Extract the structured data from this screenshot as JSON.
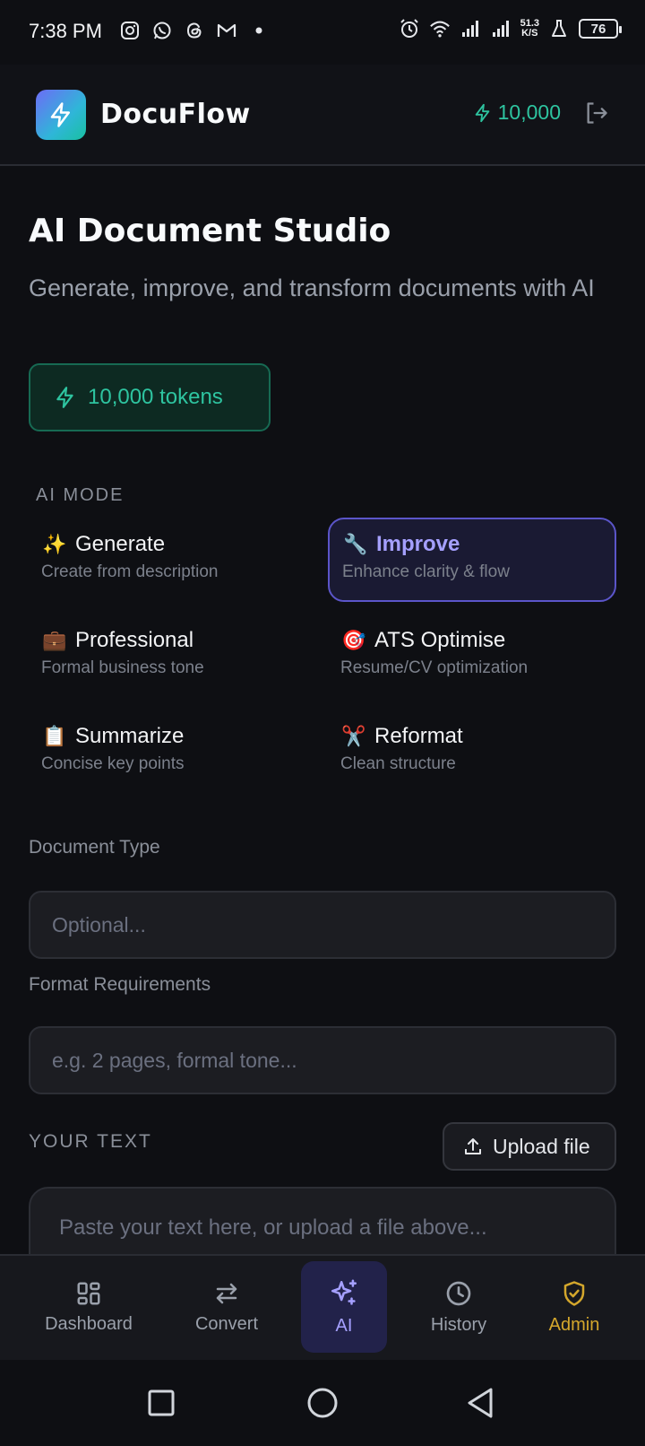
{
  "status_bar": {
    "time": "7:38 PM",
    "speed_value": "51.3",
    "speed_unit": "K/S",
    "battery": "76",
    "left_icons": [
      "instagram-icon",
      "whatsapp-icon",
      "threads-icon",
      "gmail-icon",
      "dot-icon"
    ],
    "right_icons": [
      "alarm-icon",
      "wifi-icon",
      "signal-icon",
      "signal-icon",
      "flask-icon"
    ]
  },
  "header": {
    "app_name": "DocuFlow",
    "token_count": "10,000"
  },
  "main": {
    "title": "AI Document Studio",
    "subtitle": "Generate, improve, and transform documents with AI",
    "token_pill": "10,000 tokens",
    "mode_section_label": "AI MODE",
    "modes": [
      {
        "emoji": "✨",
        "title": "Generate",
        "desc": "Create from description",
        "active": false
      },
      {
        "emoji": "🔧",
        "title": "Improve",
        "desc": "Enhance clarity & flow",
        "active": true
      },
      {
        "emoji": "💼",
        "title": "Professional",
        "desc": "Formal business tone",
        "active": false
      },
      {
        "emoji": "🎯",
        "title": "ATS Optimise",
        "desc": "Resume/CV optimization",
        "active": false
      },
      {
        "emoji": "📋",
        "title": "Summarize",
        "desc": "Concise key points",
        "active": false
      },
      {
        "emoji": "✂️",
        "title": "Reformat",
        "desc": "Clean structure",
        "active": false
      }
    ],
    "document_type": {
      "label": "Document Type",
      "placeholder": "Optional...",
      "value": ""
    },
    "format_requirements": {
      "label": "Format Requirements",
      "placeholder": "e.g. 2 pages, formal tone...",
      "value": ""
    },
    "your_text_label": "YOUR TEXT",
    "upload_label": "Upload file",
    "textarea_placeholder": "Paste your text here, or upload a file above..."
  },
  "bottom_nav": {
    "items": [
      {
        "label": "Dashboard",
        "icon": "dashboard-icon"
      },
      {
        "label": "Convert",
        "icon": "convert-icon"
      },
      {
        "label": "AI",
        "icon": "sparkles-icon",
        "active": true
      },
      {
        "label": "History",
        "icon": "history-icon"
      },
      {
        "label": "Admin",
        "icon": "shield-check-icon"
      }
    ]
  },
  "colors": {
    "background": "#0e0f13",
    "accent_green": "#2ec4a0",
    "accent_purple": "#a5a0ff",
    "admin_gold": "#d4a72c"
  }
}
